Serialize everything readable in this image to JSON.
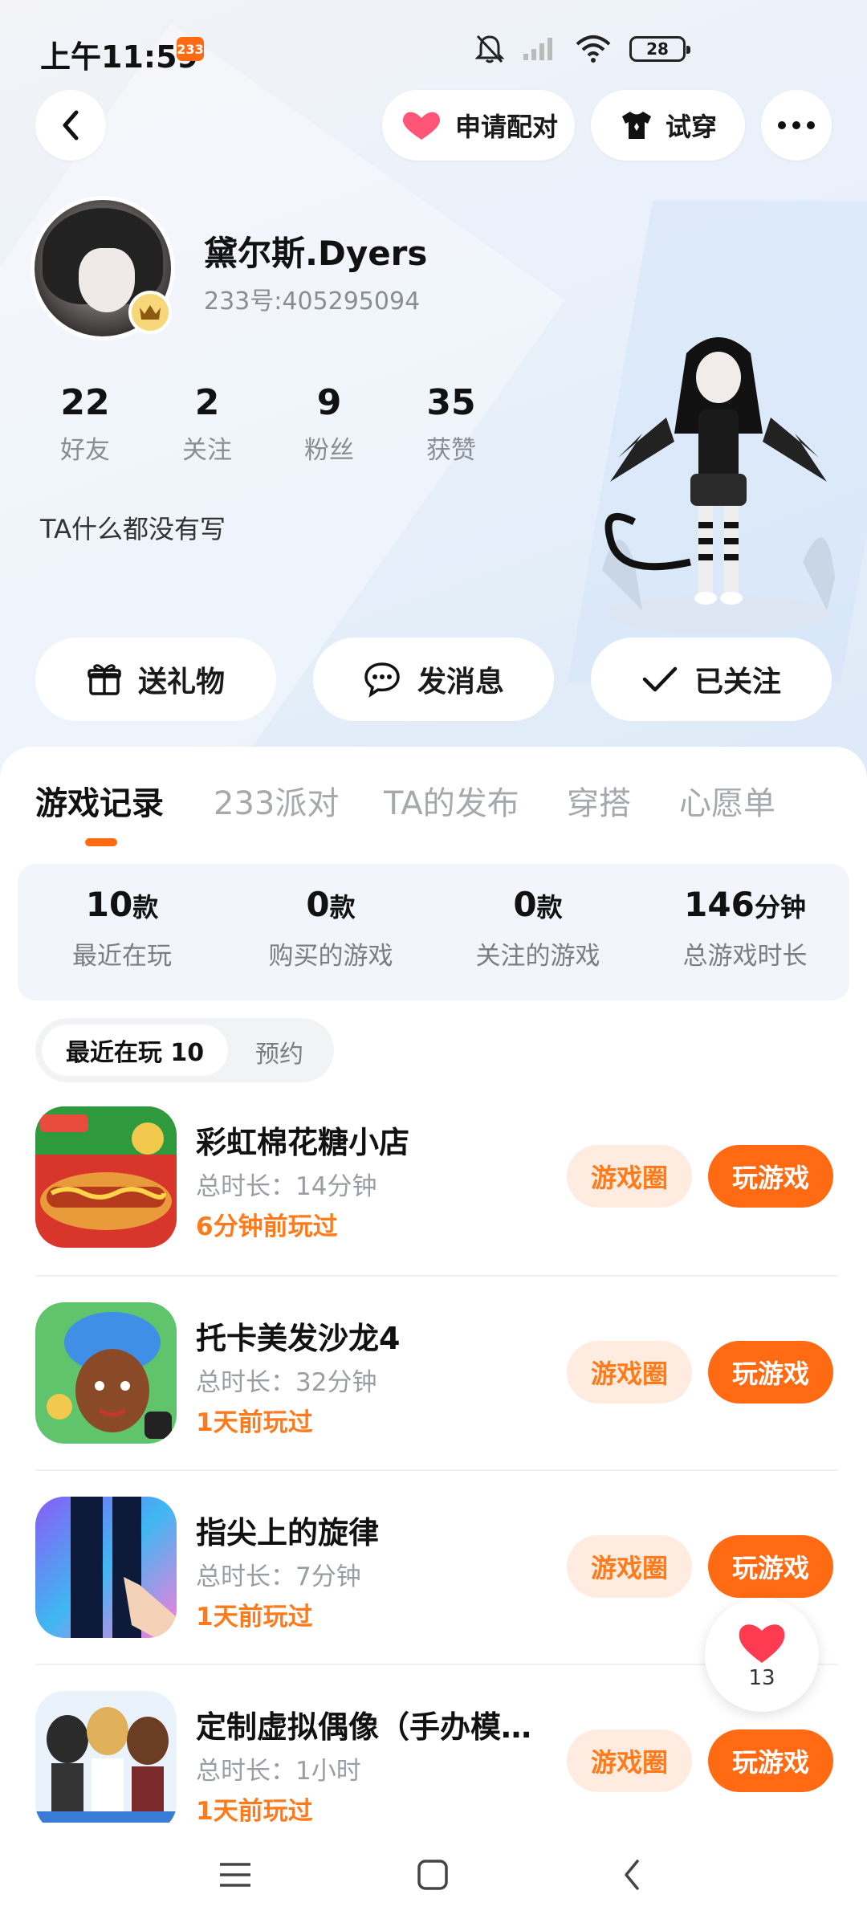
{
  "status_bar": {
    "time": "上午11:59",
    "app_badge": "233",
    "battery": "28",
    "icons": [
      "bell-off-icon",
      "signal-icon",
      "wifi-icon",
      "battery-icon"
    ]
  },
  "header": {
    "pair_label": "申请配对",
    "tryon_label": "试穿"
  },
  "profile": {
    "username": "黛尔斯.Dyers",
    "user_id": "233号:405295094",
    "stats": [
      {
        "value": "22",
        "label": "好友"
      },
      {
        "value": "2",
        "label": "关注"
      },
      {
        "value": "9",
        "label": "粉丝"
      },
      {
        "value": "35",
        "label": "获赞"
      }
    ],
    "bio": "TA什么都没有写"
  },
  "actions": {
    "gift": "送礼物",
    "message": "发消息",
    "following": "已关注"
  },
  "tabs": [
    "游戏记录",
    "233派对",
    "TA的发布",
    "穿搭",
    "心愿单"
  ],
  "summary": [
    {
      "value": "10",
      "unit": "款",
      "label": "最近在玩"
    },
    {
      "value": "0",
      "unit": "款",
      "label": "购买的游戏"
    },
    {
      "value": "0",
      "unit": "款",
      "label": "关注的游戏"
    },
    {
      "value": "146",
      "unit": "分钟",
      "label": "总游戏时长"
    }
  ],
  "segment": {
    "recent": "最近在玩 10",
    "reserve": "预约"
  },
  "games": [
    {
      "name": "彩虹棉花糖小店",
      "duration": "总时长：14分钟",
      "last_played": "6分钟前玩过",
      "circle": "游戏圈",
      "play": "玩游戏"
    },
    {
      "name": "托卡美发沙龙4",
      "duration": "总时长：32分钟",
      "last_played": "1天前玩过",
      "circle": "游戏圈",
      "play": "玩游戏"
    },
    {
      "name": "指尖上的旋律",
      "duration": "总时长：7分钟",
      "last_played": "1天前玩过",
      "circle": "游戏圈",
      "play": "玩游戏"
    },
    {
      "name": "定制虚拟偶像（手办模…",
      "duration": "总时长：1小时",
      "last_played": "1天前玩过",
      "circle": "游戏圈",
      "play": "玩游戏"
    }
  ],
  "like_fab": {
    "count": "13"
  },
  "colors": {
    "accent": "#ff6a13",
    "accent_light": "#ffece0"
  }
}
